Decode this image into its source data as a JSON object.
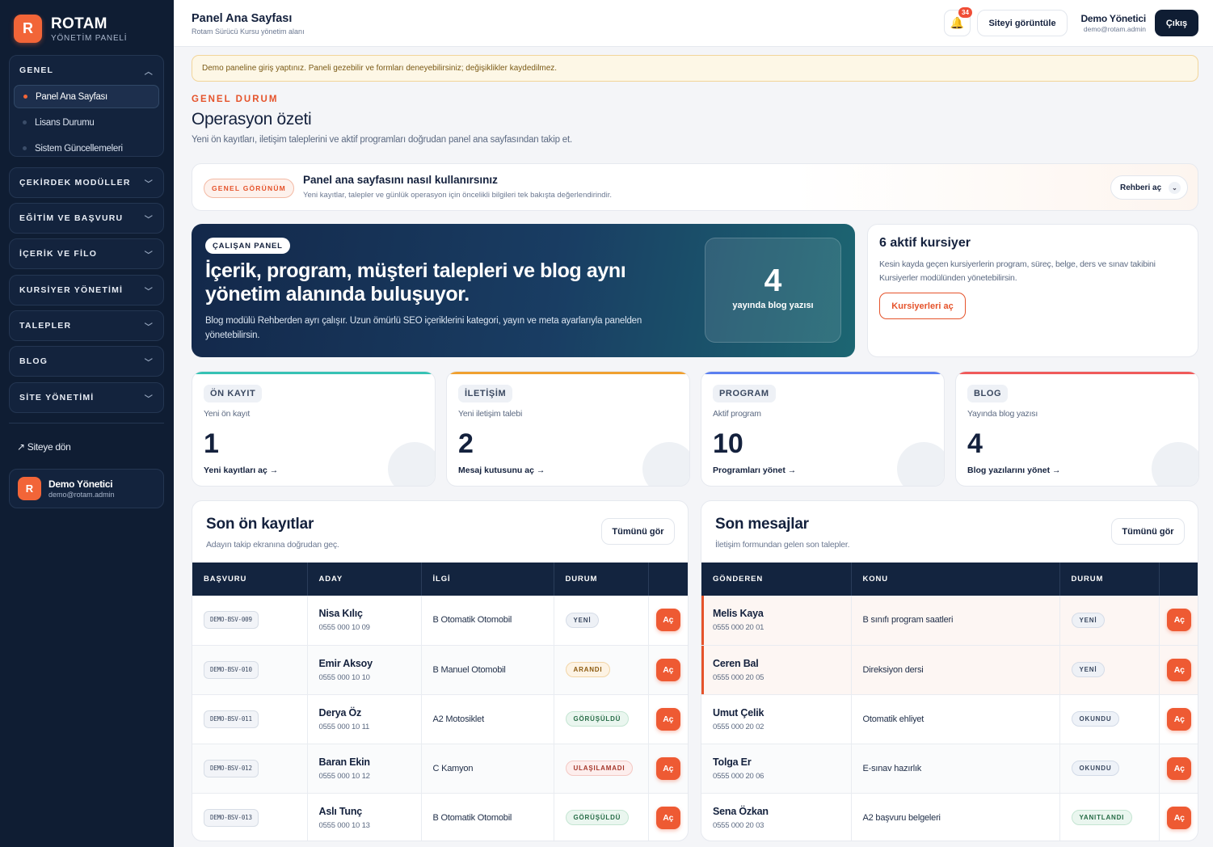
{
  "brand": {
    "logo_letter": "R",
    "name": "ROTAM",
    "subtitle": "YÖNETİM PANELİ"
  },
  "sidebar": {
    "groups": [
      {
        "label": "GENEL",
        "expanded": true,
        "items": [
          {
            "label": "Panel Ana Sayfası",
            "active": true
          },
          {
            "label": "Lisans Durumu",
            "active": false
          },
          {
            "label": "Sistem Güncellemeleri",
            "active": false
          }
        ]
      },
      {
        "label": "ÇEKİRDEK MODÜLLER",
        "expanded": false
      },
      {
        "label": "EĞİTİM VE BAŞVURU",
        "expanded": false
      },
      {
        "label": "İÇERİK VE FİLO",
        "expanded": false
      },
      {
        "label": "KURSİYER YÖNETİMİ",
        "expanded": false
      },
      {
        "label": "TALEPLER",
        "expanded": false
      },
      {
        "label": "BLOG",
        "expanded": false
      },
      {
        "label": "SİTE YÖNETİMİ",
        "expanded": false
      }
    ],
    "back_link": "↗ Siteye dön",
    "user": {
      "initial": "R",
      "name": "Demo Yönetici",
      "email": "demo@rotam.admin"
    }
  },
  "topbar": {
    "title": "Panel Ana Sayfası",
    "subtitle": "Rotam Sürücü Kursu yönetim alanı",
    "notification_count": "34",
    "view_site_label": "Siteyi görüntüle",
    "user_name": "Demo Yönetici",
    "user_email": "demo@rotam.admin",
    "logout_label": "Çıkış"
  },
  "notice": "Demo paneline giriş yaptınız. Paneli gezebilir ve formları deneyebilirsiniz; değişiklikler kaydedilmez.",
  "overview": {
    "eyebrow": "GENEL DURUM",
    "title": "Operasyon özeti",
    "lead": "Yeni ön kayıtları, iletişim taleplerini ve aktif programları doğrudan panel ana sayfasından takip et."
  },
  "guide": {
    "pill": "GENEL GÖRÜNÜM",
    "title": "Panel ana sayfasını nasıl kullanırsınız",
    "subtitle": "Yeni kayıtlar, talepler ve günlük operasyon için öncelikli bilgileri tek bakışta değerlendirindir.",
    "button": "Rehberi aç",
    "button_chevron": "⌄"
  },
  "hero": {
    "pill": "ÇALIŞAN PANEL",
    "title": "İçerik, program, müşteri talepleri ve blog aynı yönetim alanında buluşuyor.",
    "text": "Blog modülü Rehberden ayrı çalışır. Uzun ömürlü SEO içeriklerini kategori, yayın ve meta ayarlarıyla panelden yönetebilirsin.",
    "stat_value": "4",
    "stat_label": "yayında blog yazısı"
  },
  "students_card": {
    "title": "6 aktif kursiyer",
    "text": "Kesin kayda geçen kursiyerlerin program, süreç, belge, ders ve sınav takibini Kursiyerler modülünden yönetebilirsin.",
    "button": "Kursiyerleri aç"
  },
  "stats": [
    {
      "tag": "ÖN KAYIT",
      "label": "Yeni ön kayıt",
      "value": "1",
      "link": "Yeni kayıtları aç →",
      "color": "#36c2b4"
    },
    {
      "tag": "İLETİŞİM",
      "label": "Yeni iletişim talebi",
      "value": "2",
      "link": "Mesaj kutusunu aç →",
      "color": "#f0a030"
    },
    {
      "tag": "PROGRAM",
      "label": "Aktif program",
      "value": "10",
      "link": "Programları yönet →",
      "color": "#5b7ff0"
    },
    {
      "tag": "BLOG",
      "label": "Yayında blog yazısı",
      "value": "4",
      "link": "Blog yazılarını yönet →",
      "color": "#f05a5a"
    }
  ],
  "registrations": {
    "title": "Son ön kayıtlar",
    "subtitle": "Adayın takip ekranına doğrudan geç.",
    "view_all": "Tümünü gör",
    "columns": [
      "BAŞVURU",
      "ADAY",
      "İLGİ",
      "DURUM",
      ""
    ],
    "rows": [
      {
        "code": "DEMO-BSV-009",
        "name": "Nisa Kılıç",
        "phone": "0555 000 10 09",
        "interest": "B Otomatik Otomobil",
        "status": "YENİ",
        "status_key": "yeni",
        "action": "Aç"
      },
      {
        "code": "DEMO-BSV-010",
        "name": "Emir Aksoy",
        "phone": "0555 000 10 10",
        "interest": "B Manuel Otomobil",
        "status": "ARANDI",
        "status_key": "arandi",
        "action": "Aç"
      },
      {
        "code": "DEMO-BSV-011",
        "name": "Derya Öz",
        "phone": "0555 000 10 11",
        "interest": "A2 Motosiklet",
        "status": "GÖRÜŞÜLDÜ",
        "status_key": "gorusuldu",
        "action": "Aç"
      },
      {
        "code": "DEMO-BSV-012",
        "name": "Baran Ekin",
        "phone": "0555 000 10 12",
        "interest": "C Kamyon",
        "status": "ULAŞILAMADI",
        "status_key": "ulasilamadi",
        "action": "Aç"
      },
      {
        "code": "DEMO-BSV-013",
        "name": "Aslı Tunç",
        "phone": "0555 000 10 13",
        "interest": "B Otomatik Otomobil",
        "status": "GÖRÜŞÜLDÜ",
        "status_key": "gorusuldu",
        "action": "Aç"
      }
    ]
  },
  "messages": {
    "title": "Son mesajlar",
    "subtitle": "İletişim formundan gelen son talepler.",
    "view_all": "Tümünü gör",
    "columns": [
      "GÖNDEREN",
      "KONU",
      "DURUM",
      ""
    ],
    "rows": [
      {
        "name": "Melis Kaya",
        "phone": "0555 000 20 01",
        "subject": "B sınıfı program saatleri",
        "status": "YENİ",
        "status_key": "yeni",
        "highlight": true,
        "action": "Aç"
      },
      {
        "name": "Ceren Bal",
        "phone": "0555 000 20 05",
        "subject": "Direksiyon dersi",
        "status": "YENİ",
        "status_key": "yeni",
        "highlight": true,
        "action": "Aç"
      },
      {
        "name": "Umut Çelik",
        "phone": "0555 000 20 02",
        "subject": "Otomatik ehliyet",
        "status": "OKUNDU",
        "status_key": "okundu",
        "highlight": false,
        "action": "Aç"
      },
      {
        "name": "Tolga Er",
        "phone": "0555 000 20 06",
        "subject": "E-sınav hazırlık",
        "status": "OKUNDU",
        "status_key": "okundu",
        "highlight": false,
        "action": "Aç"
      },
      {
        "name": "Sena Özkan",
        "phone": "0555 000 20 03",
        "subject": "A2 başvuru belgeleri",
        "status": "YANITLANDI",
        "status_key": "yanitlandi",
        "highlight": false,
        "action": "Aç"
      }
    ]
  }
}
